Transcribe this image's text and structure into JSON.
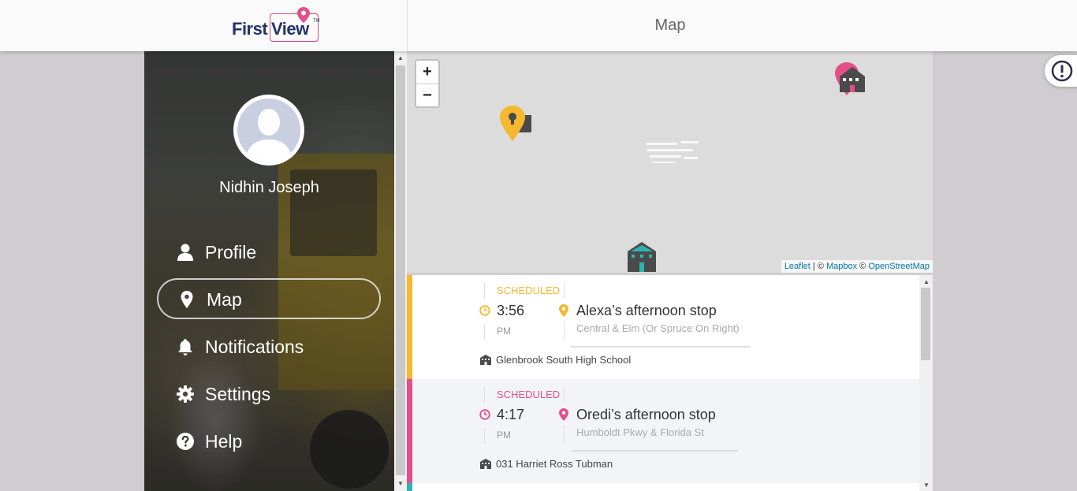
{
  "header": {
    "logo_text_first": "First",
    "logo_text_view": "View",
    "logo_tm": "TM",
    "title": "Map"
  },
  "sidebar": {
    "user_name": "Nidhin Joseph",
    "items": [
      {
        "label": "Profile",
        "icon": "person-icon",
        "active": false
      },
      {
        "label": "Map",
        "icon": "map-pin-icon",
        "active": true
      },
      {
        "label": "Notifications",
        "icon": "bell-icon",
        "active": false
      },
      {
        "label": "Settings",
        "icon": "gear-icon",
        "active": false
      },
      {
        "label": "Help",
        "icon": "help-circle-icon",
        "active": false
      }
    ]
  },
  "map": {
    "zoom_in": "+",
    "zoom_out": "−",
    "attribution": {
      "leaflet": "Leaflet",
      "sep": " | © ",
      "mapbox": "Mapbox",
      "copy": " © ",
      "osm": "OpenStreetMap"
    },
    "markers": [
      {
        "type": "school",
        "color": "#e44f8a"
      },
      {
        "type": "bus-stop",
        "color": "#f5b82e"
      },
      {
        "type": "school",
        "color": "#2cb5b0"
      }
    ]
  },
  "stops": [
    {
      "status": "SCHEDULED",
      "time": "3:56",
      "ampm": "PM",
      "name": "Alexa’s afternoon stop",
      "address": "Central & Elm (Or Spruce On Right)",
      "school": "Glenbrook South High School",
      "color": "#f5b82e",
      "bg": "#ffffff"
    },
    {
      "status": "SCHEDULED",
      "time": "4:17",
      "ampm": "PM",
      "name": "Oredi’s afternoon stop",
      "address": "Humboldt Pkwy & Florida St",
      "school": "031 Harriet Ross Tubman",
      "color": "#e44f8a",
      "bg": "#f3f4f8"
    }
  ],
  "colors": {
    "brand_navy": "#22336b",
    "brand_pink": "#e44f8a",
    "stop_yellow": "#f5b82e",
    "stop_teal": "#2cb5b0"
  }
}
